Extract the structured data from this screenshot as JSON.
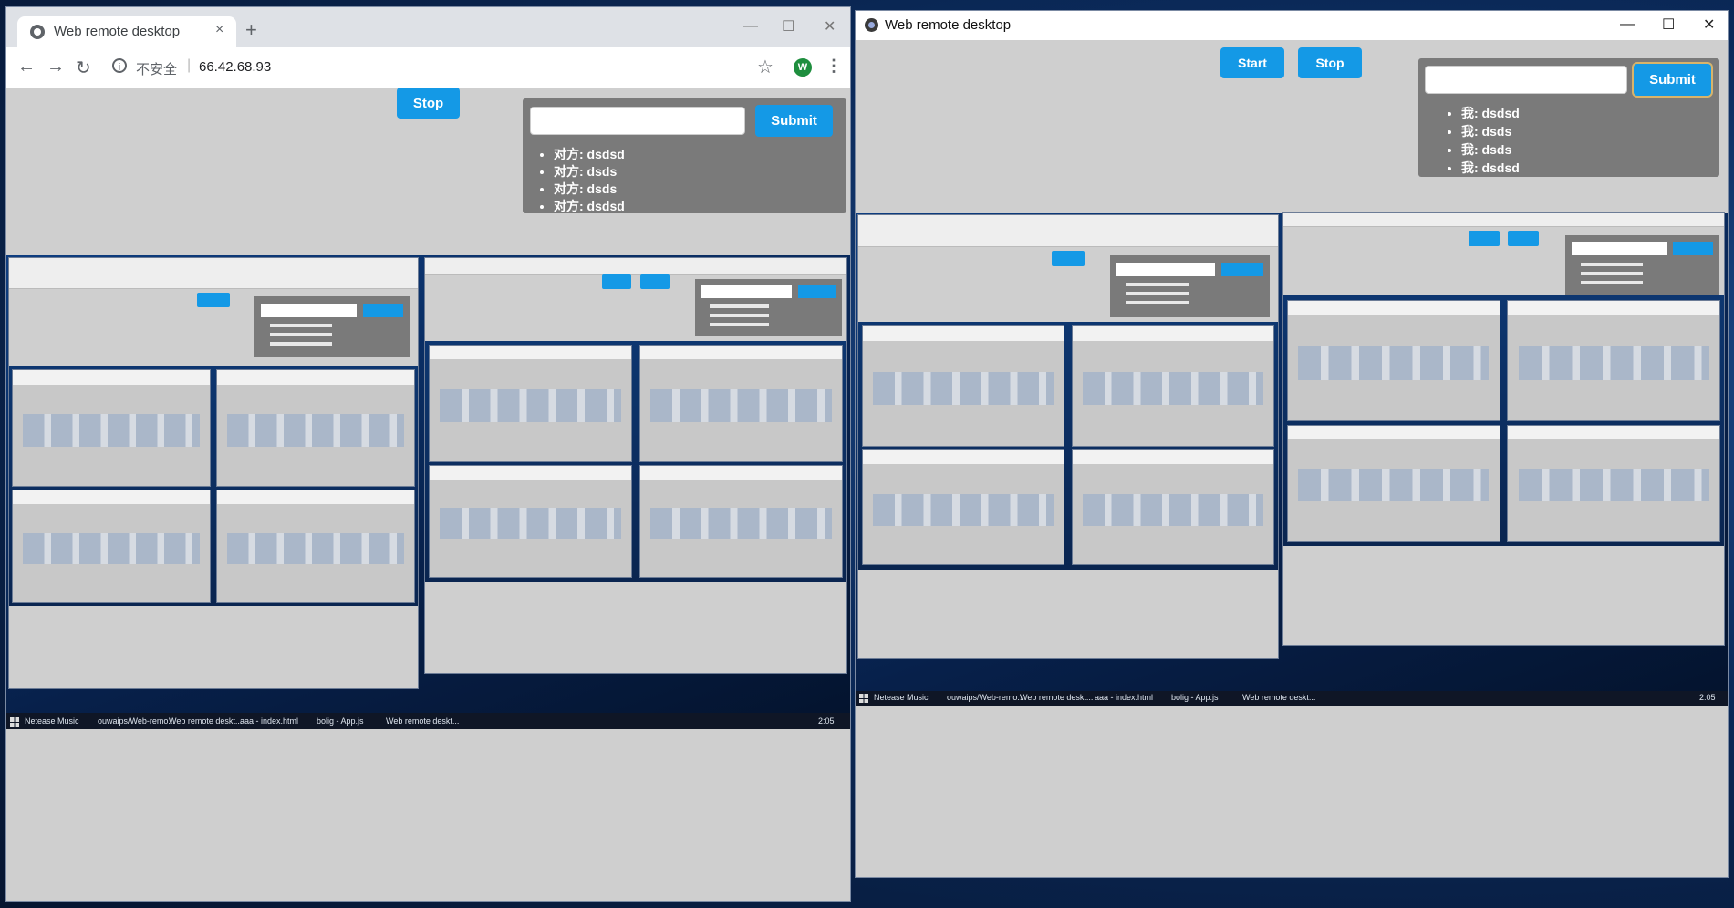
{
  "chrome_window": {
    "tab_title": "Web remote desktop",
    "tab_close": "×",
    "new_tab": "+",
    "minimize": "—",
    "maximize": "☐",
    "close": "✕",
    "back": "←",
    "forward": "→",
    "reload": "↻",
    "info_icon": "i",
    "insecure_label": "不安全",
    "separator": "|",
    "url": "66.42.68.93",
    "bookmark": "☆",
    "profile_initial": "W",
    "menu": "⋮",
    "app": {
      "stop_label": "Stop",
      "submit_label": "Submit",
      "chat_input": "",
      "messages": [
        "对方: dsdsd",
        "对方: dsds",
        "对方: dsds",
        "对方: dsdsd"
      ]
    }
  },
  "app_window": {
    "title": "Web remote desktop",
    "minimize": "—",
    "maximize": "☐",
    "close": "✕",
    "start_label": "Start",
    "stop_label": "Stop",
    "submit_label": "Submit",
    "chat_input": "",
    "messages": [
      "我: dsdsd",
      "我: dsds",
      "我: dsds",
      "我: dsdsd"
    ]
  },
  "remote_taskbar": {
    "items": [
      "Netease Music",
      "ouwaips/Web-remo...",
      "Web remote deskt...",
      "aaa - index.html",
      "bolig - App.js",
      "Web remote deskt..."
    ],
    "time": "2:05"
  },
  "colors": {
    "accent": "#1499e6",
    "panel": "#7a7a7a",
    "canvas": "#cfcfcf",
    "desktop": "#0b2a5a"
  }
}
